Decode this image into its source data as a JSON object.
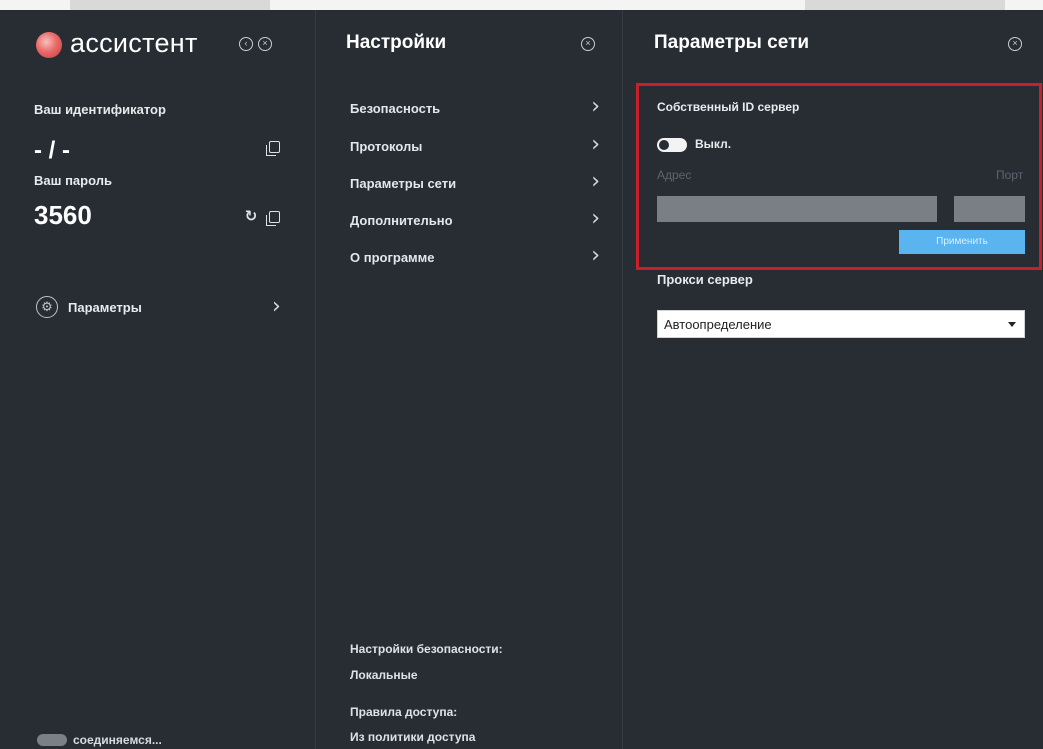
{
  "main_panel": {
    "app_name": "ассистент",
    "id_label": "Ваш идентификатор",
    "id_value": "- / -",
    "password_label": "Ваш пароль",
    "password_value": "3560",
    "parameters_label": "Параметры",
    "status_text": "соединяемся..."
  },
  "settings_panel": {
    "title": "Настройки",
    "items": [
      {
        "label": "Безопасность"
      },
      {
        "label": "Протоколы"
      },
      {
        "label": "Параметры сети"
      },
      {
        "label": "Дополнительно"
      },
      {
        "label": "О программе"
      }
    ],
    "security_settings_label": "Настройки безопасности:",
    "security_settings_value": "Локальные",
    "access_rules_label": "Правила доступа:",
    "access_rules_value": "Из политики доступа"
  },
  "network_panel": {
    "title": "Параметры сети",
    "own_id_server_label": "Собственный ID сервер",
    "toggle_state_label": "Выкл.",
    "address_label": "Адрес",
    "port_label": "Порт",
    "address_value": "",
    "port_value": "",
    "apply_label": "Применить",
    "proxy_label": "Прокси сервер",
    "proxy_value": "Автоопределение"
  },
  "icons": {
    "minimize": "chevron-left-circle-icon",
    "close": "close-circle-icon",
    "copy": "copy-icon",
    "refresh": "refresh-icon",
    "gear": "gear-icon",
    "chevron": "chevron-right-icon"
  },
  "colors": {
    "background": "#272d33",
    "accent_blue": "#59b4f0",
    "highlight_red": "#c8202a",
    "input_gray": "#7a7f85"
  }
}
